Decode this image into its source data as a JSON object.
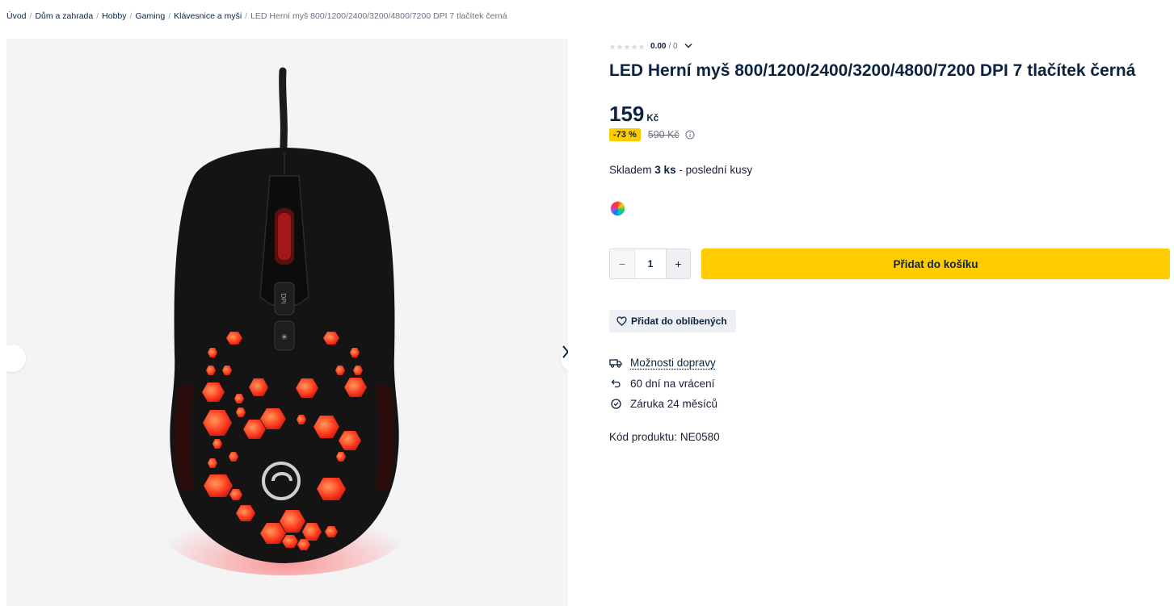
{
  "breadcrumb": {
    "items": [
      "Úvod",
      "Dům a zahrada",
      "Hobby",
      "Gaming",
      "Klávesnice a myši"
    ],
    "separator": "/",
    "current": "LED Herní myš 800/1200/2400/3200/4800/7200 DPI 7 tlačítek černá"
  },
  "gallery": {
    "image_alt": "product-photo-gaming-mouse",
    "prev_icon": "chevron-left-icon",
    "next_icon": "chevron-right-icon"
  },
  "rating": {
    "stars_filled": 0,
    "stars_total": 5,
    "score": "0.00",
    "count": "/ 0"
  },
  "product": {
    "title": "LED Herní myš 800/1200/2400/3200/4800/7200 DPI 7 tlačítek černá",
    "price": "159",
    "currency": "Kč",
    "discount": "-73 %",
    "old_price": "590 Kč",
    "stock_prefix": "Skladem",
    "stock_qty": "3 ks",
    "stock_suffix": "- poslední kusy",
    "code_label": "Kód produktu:",
    "code_value": "NE0580"
  },
  "quantity": {
    "minus": "−",
    "value": "1",
    "plus": "+"
  },
  "buttons": {
    "add_to_cart": "Přidat do košíku",
    "add_to_favorites": "Přidat do oblíbených"
  },
  "features": [
    {
      "icon": "truck-icon",
      "label": "Možnosti dopravy"
    },
    {
      "icon": "return-arrow-icon",
      "label": "60 dní na vrácení"
    },
    {
      "icon": "check-circle-icon",
      "label": "Záruka 24 měsíců"
    }
  ],
  "colors": {
    "accent": "#ffcc00",
    "text_dark": "#0b2341",
    "muted": "#6b7280"
  }
}
